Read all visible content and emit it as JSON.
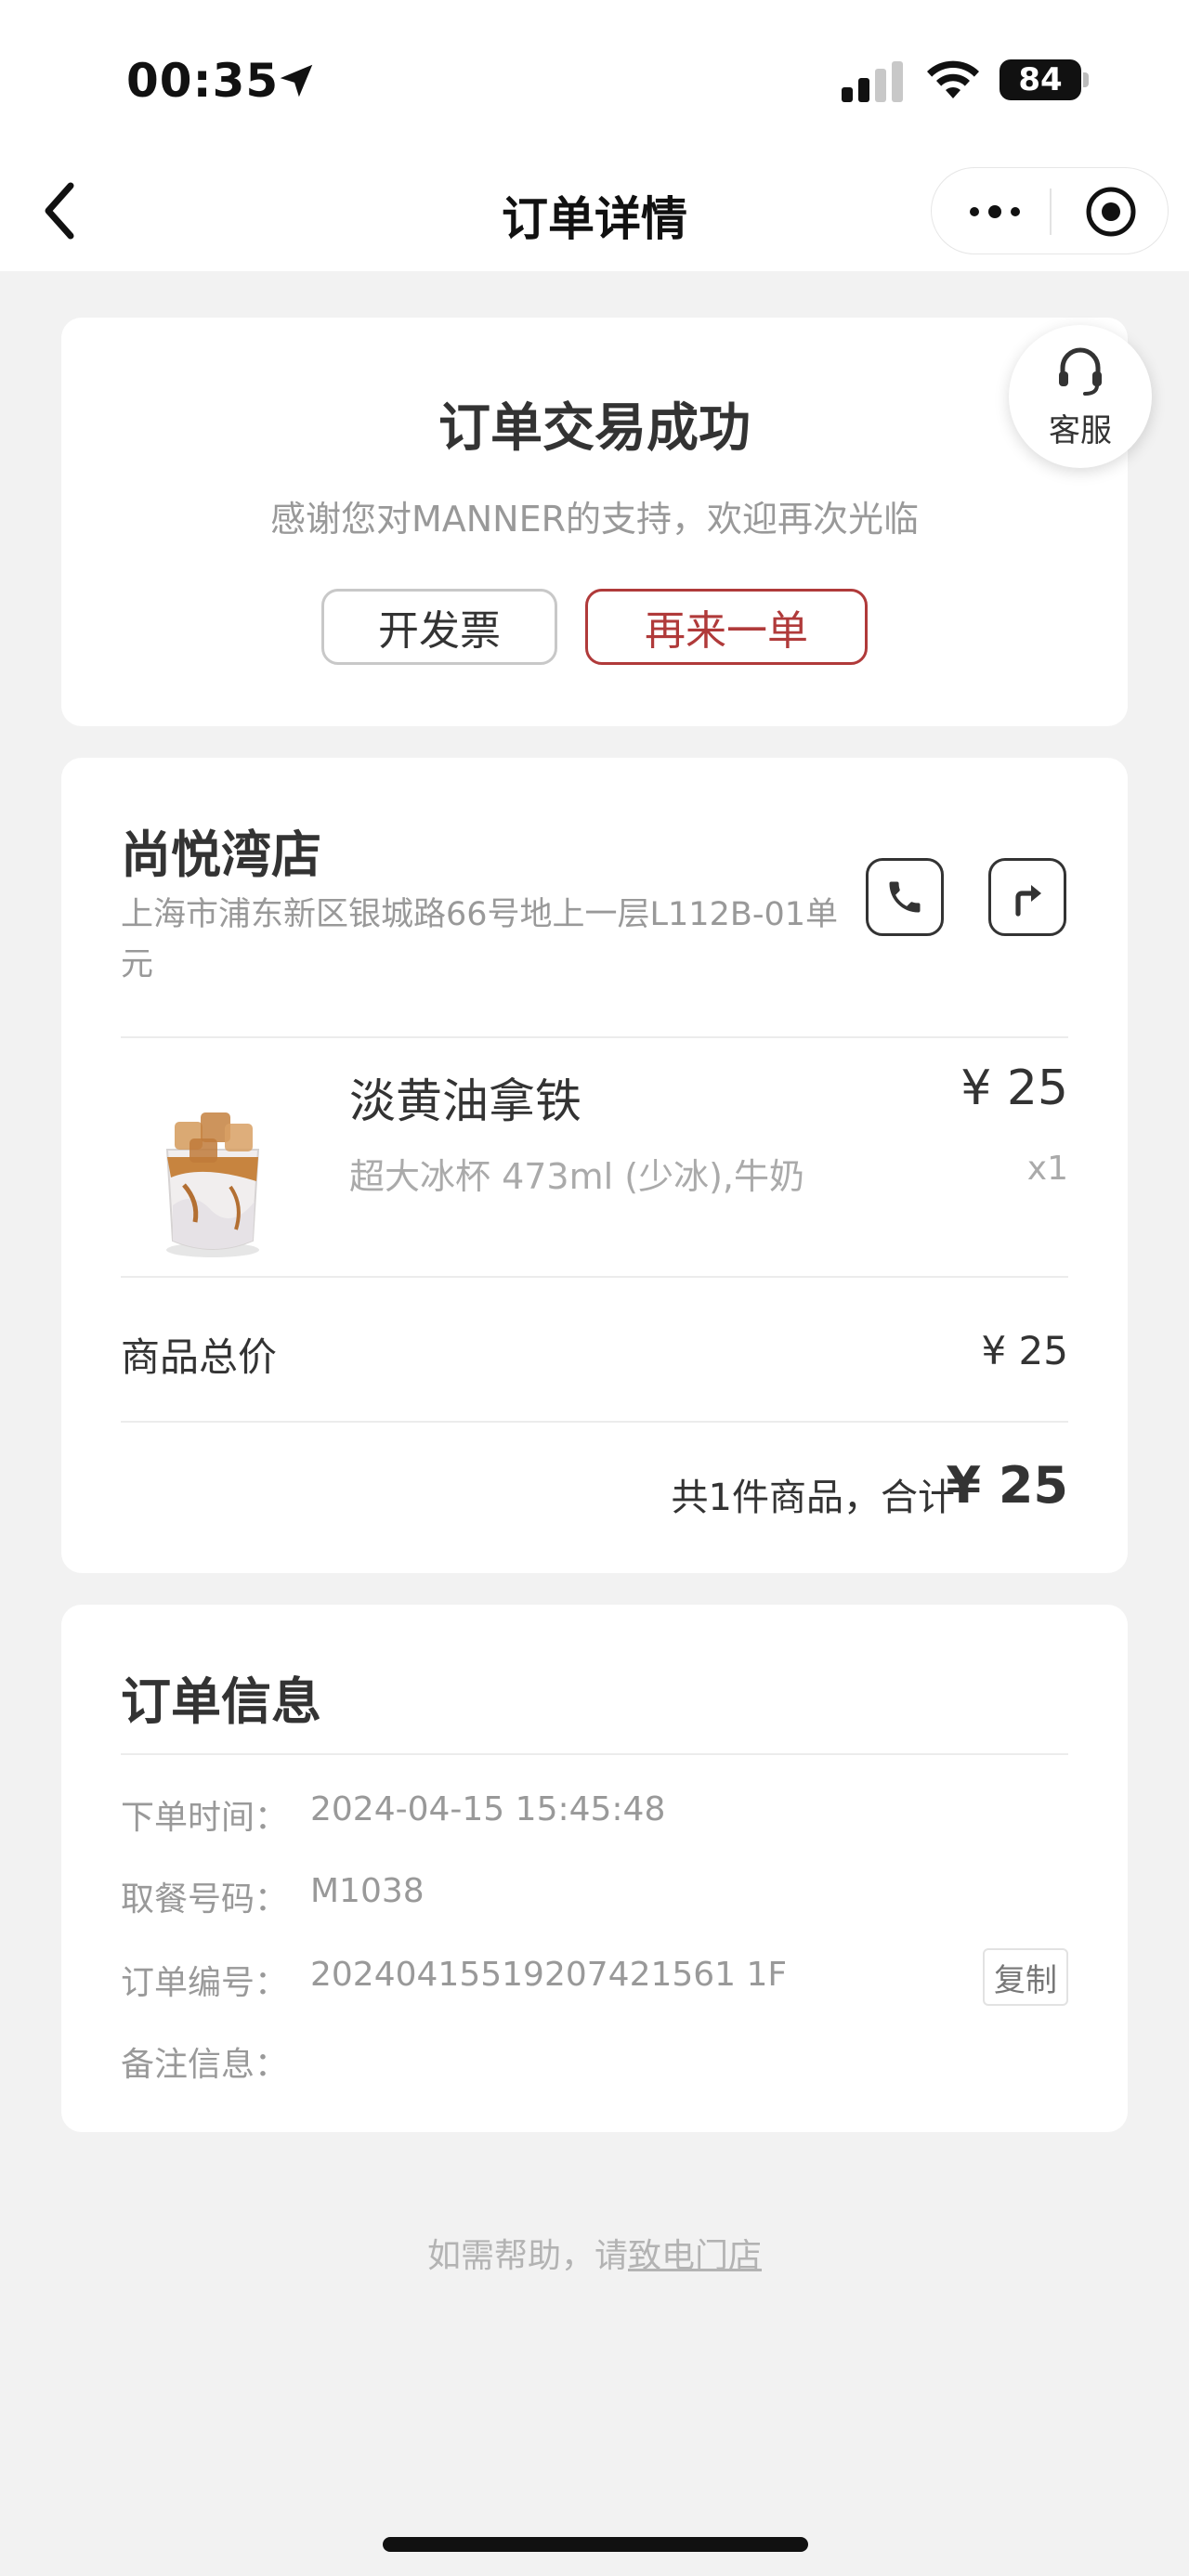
{
  "status_bar": {
    "time": "00:35",
    "battery": "84"
  },
  "nav": {
    "title": "订单详情"
  },
  "success": {
    "title": "订单交易成功",
    "subtitle": "感谢您对MANNER的支持，欢迎再次光临",
    "invoice_button": "开发票",
    "reorder_button": "再来一单"
  },
  "customer_service": {
    "label": "客服"
  },
  "store": {
    "name": "尚悦湾店",
    "address": "上海市浦东新区银城路66号地上一层L112B-01单元"
  },
  "item": {
    "name": "淡黄油拿铁",
    "price": "¥ 25",
    "spec": "超大冰杯 473ml (少冰),牛奶",
    "quantity": "x1"
  },
  "totals": {
    "goods_total_label": "商品总价",
    "goods_total_value": "¥ 25",
    "summary_text": "共1件商品，合计",
    "summary_amount": "¥ 25"
  },
  "order_info": {
    "title": "订单信息",
    "rows": [
      {
        "label": "下单时间：",
        "value": "2024-04-15 15:45:48"
      },
      {
        "label": "取餐号码：",
        "value": "M1038"
      },
      {
        "label": "订单编号：",
        "value": "20240415519207421561 1F"
      },
      {
        "label": "备注信息：",
        "value": ""
      }
    ],
    "copy_button": "复制"
  },
  "help": {
    "prefix": "如需帮助，请",
    "link": "致电门店"
  },
  "colors": {
    "accent": "#b03a3a",
    "background": "#f2f2f2"
  }
}
